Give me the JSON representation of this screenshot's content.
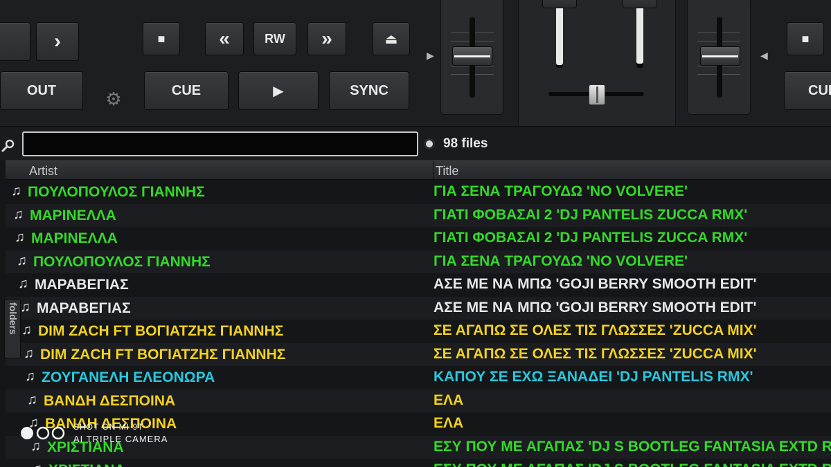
{
  "deck": {
    "next_label": "›",
    "out_label": "OUT",
    "stop_label": "■",
    "rewind_label": "«",
    "rw_label": "RW",
    "forward_label": "»",
    "eject_label": "⏏",
    "cue_label": "CUE",
    "play_label": "▶",
    "sync_label": "SYNC",
    "right_stop_label": "■",
    "right_cue_label": "CUE"
  },
  "search": {
    "value": "",
    "files_count": "98 files"
  },
  "browser": {
    "columns": {
      "artist": "Artist",
      "title": "Title"
    },
    "folders_tab": "folders",
    "rows": [
      {
        "artist": "ΠΟΥΛΟΠΟΥΛΟΣ ΓΙΑΝΝΗΣ",
        "title": "ΓΙΑ ΣΕΝΑ ΤΡΑΓΟΥΔΩ 'NO VOLVERE'",
        "color": "#34d92a"
      },
      {
        "artist": "ΜΑΡΙΝΕΛΛΑ",
        "title": "ΓΙΑΤΙ ΦΟΒΑΣΑΙ 2 'DJ PANTELIS ZUCCA RMX'",
        "color": "#34d92a"
      },
      {
        "artist": "ΜΑΡΙΝΕΛΛΑ",
        "title": "ΓΙΑΤΙ ΦΟΒΑΣΑΙ 2 'DJ PANTELIS ZUCCA RMX'",
        "color": "#34d92a"
      },
      {
        "artist": "ΠΟΥΛΟΠΟΥΛΟΣ ΓΙΑΝΝΗΣ",
        "title": "ΓΙΑ ΣΕΝΑ ΤΡΑΓΟΥΔΩ 'NO VOLVERE'",
        "color": "#34d92a"
      },
      {
        "artist": "ΜΑΡΑΒΕΓΙΑΣ",
        "title": "ΑΣΕ ΜΕ ΝΑ ΜΠΩ 'GOJI BERRY SMOOTH EDIT'",
        "color": "#e8e8ea"
      },
      {
        "artist": "ΜΑΡΑΒΕΓΙΑΣ",
        "title": "ΑΣΕ ΜΕ ΝΑ ΜΠΩ 'GOJI BERRY SMOOTH EDIT'",
        "color": "#e8e8ea"
      },
      {
        "artist": "DIM ZACH FT ΒΟΓΙΑΤΖΗΣ ΓΙΑΝΝΗΣ",
        "title": "ΣΕ ΑΓΑΠΩ ΣΕ ΟΛΕΣ ΤΙΣ ΓΛΩΣΣΕΣ 'ZUCCA MIX'",
        "color": "#f2d21c"
      },
      {
        "artist": "DIM ZACH FT ΒΟΓΙΑΤΖΗΣ ΓΙΑΝΝΗΣ",
        "title": "ΣΕ ΑΓΑΠΩ ΣΕ ΟΛΕΣ ΤΙΣ ΓΛΩΣΣΕΣ 'ZUCCA MIX'",
        "color": "#f2d21c"
      },
      {
        "artist": "ΖΟΥΓΑΝΕΛΗ ΕΛΕΟΝΩΡΑ",
        "title": "ΚΑΠΟΥ ΣΕ ΕΧΩ ΞΑΝΑΔΕΙ 'DJ PANTELIS RMX'",
        "color": "#27c9e0"
      },
      {
        "artist": "ΒΑΝΔΗ ΔΕΣΠΟΙΝΑ",
        "title": "ΕΛΑ",
        "color": "#f2d21c"
      },
      {
        "artist": "ΒΑΝΔΗ ΔΕΣΠΟΙΝΑ",
        "title": "ΕΛΑ",
        "color": "#f2d21c"
      },
      {
        "artist": "ΧΡΙΣΤΙΑΝΑ",
        "title": "ΕΣΥ ΠΟΥ ΜΕ ΑΓΑΠΑΣ 'DJ S BOOTLEG FANTASIA EXTD RMX",
        "color": "#34d92a"
      },
      {
        "artist": "ΧΡΙΣΤΙΑΝΑ",
        "title": "ΕΣΥ ΠΟΥ ΜΕ ΑΓΑΠΑΣ 'DJ S BOOTLEG FANTASIA EXTD RMX",
        "color": "#34d92a"
      }
    ]
  },
  "watermark": {
    "line1": "SHOT ON MI 9T",
    "line2": "AI TRIPLE CAMERA"
  },
  "colors": {
    "green": "#34d92a",
    "white": "#e8e8ea",
    "yellow": "#f2d21c",
    "cyan": "#27c9e0"
  }
}
